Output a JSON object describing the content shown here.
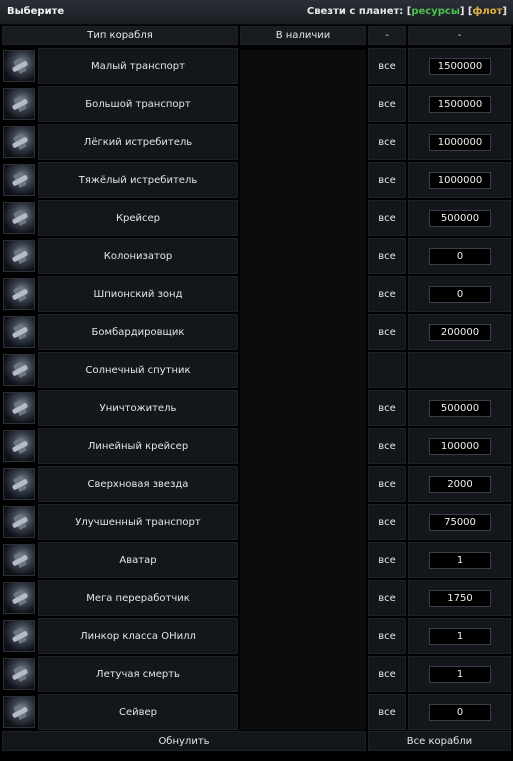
{
  "header": {
    "title": "Выберите",
    "connect_label": "Свезти с планет:",
    "bracket_open": "[",
    "bracket_close": "]",
    "resources_link": "ресурсы",
    "fleet_link": "флот"
  },
  "table": {
    "columns": [
      "Тип корабля",
      "В наличии",
      "-",
      "-"
    ],
    "ships": [
      {
        "name": "Малый транспорт",
        "all": "все",
        "amount": "1500000"
      },
      {
        "name": "Большой транспорт",
        "all": "все",
        "amount": "1500000"
      },
      {
        "name": "Лёгкий истребитель",
        "all": "все",
        "amount": "1000000"
      },
      {
        "name": "Тяжёлый истребитель",
        "all": "все",
        "amount": "1000000"
      },
      {
        "name": "Крейсер",
        "all": "все",
        "amount": "500000"
      },
      {
        "name": "Колонизатор",
        "all": "все",
        "amount": "0"
      },
      {
        "name": "Шпионский зонд",
        "all": "все",
        "amount": "0"
      },
      {
        "name": "Бомбардировщик",
        "all": "все",
        "amount": "200000"
      },
      {
        "name": "Солнечный спутник",
        "all": "",
        "amount": ""
      },
      {
        "name": "Уничтожитель",
        "all": "все",
        "amount": "500000"
      },
      {
        "name": "Линейный крейсер",
        "all": "все",
        "amount": "100000"
      },
      {
        "name": "Сверхновая звезда",
        "all": "все",
        "amount": "2000"
      },
      {
        "name": "Улучшенный транспорт",
        "all": "все",
        "amount": "75000"
      },
      {
        "name": "Аватар",
        "all": "все",
        "amount": "1"
      },
      {
        "name": "Мега переработчик",
        "all": "все",
        "amount": "1750"
      },
      {
        "name": "Линкор класса ОНилл",
        "all": "все",
        "amount": "1"
      },
      {
        "name": "Летучая смерть",
        "all": "все",
        "amount": "1"
      },
      {
        "name": "Сейвер",
        "all": "все",
        "amount": "0"
      }
    ]
  },
  "footer": {
    "reset": "Обнулить",
    "all_ships": "Все корабли"
  },
  "colors": {
    "resources": "#4ec24e",
    "fleet": "#e0b040",
    "background": "#000000",
    "cell": "#13161b"
  }
}
